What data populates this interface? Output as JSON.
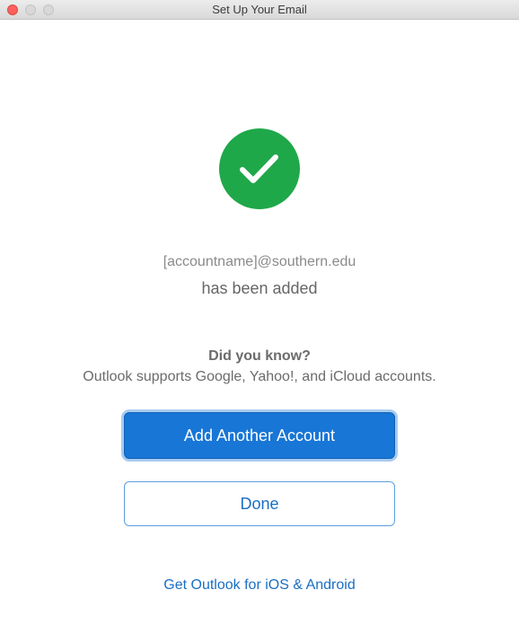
{
  "window": {
    "title": "Set Up Your Email"
  },
  "status": {
    "icon": "checkmark-icon",
    "icon_color": "#1fa84a",
    "account": "[accountname]@southern.edu",
    "message": "has been added"
  },
  "tip": {
    "heading": "Did you know?",
    "body": "Outlook supports Google, Yahoo!, and iCloud accounts."
  },
  "actions": {
    "add_account_label": "Add Another Account",
    "done_label": "Done",
    "mobile_link_label": "Get Outlook for iOS & Android"
  },
  "colors": {
    "accent": "#1876d6",
    "link": "#1a6fc4",
    "success": "#1fa84a"
  }
}
